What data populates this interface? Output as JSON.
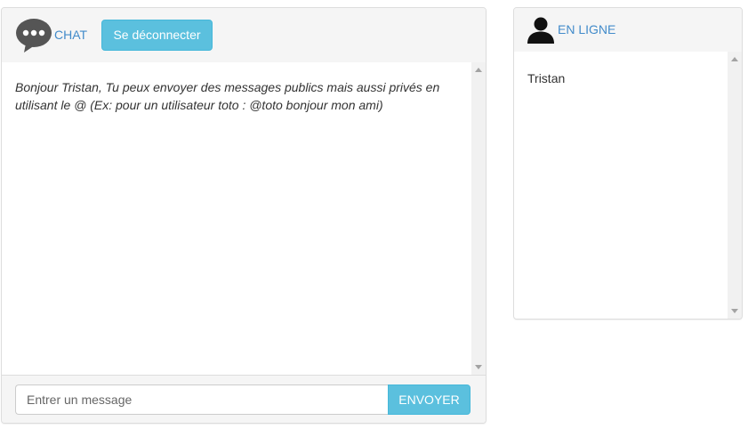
{
  "chat": {
    "title": "CHAT",
    "logout_label": "Se déconnecter",
    "messages": [
      "Bonjour Tristan, Tu peux envoyer des messages publics mais aussi privés en utilisant le @ (Ex: pour un utilisateur toto : @toto bonjour mon ami)"
    ],
    "input": {
      "value": "",
      "placeholder": "Entrer un message"
    },
    "send_label": "ENVOYER",
    "icon": "chat-bubble-icon"
  },
  "online": {
    "title": "EN LIGNE",
    "icon": "user-icon",
    "users": [
      "Tristan"
    ]
  },
  "colors": {
    "accent": "#428bca",
    "button": "#5bc0de",
    "heading_bg": "#f5f5f5",
    "border": "#dddddd"
  }
}
